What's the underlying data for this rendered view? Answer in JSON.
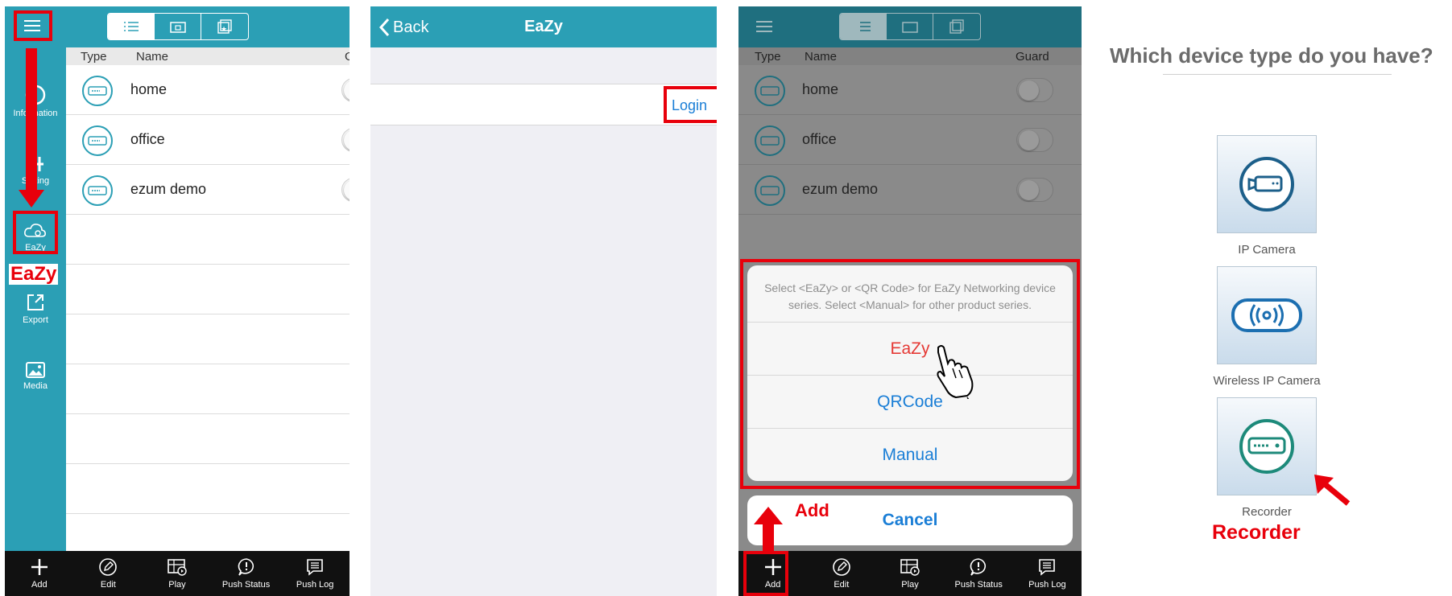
{
  "colors": {
    "accent": "#2b9fb5",
    "accent_dim": "#1f6f7f",
    "annotation_red": "#e8000b",
    "link_blue": "#1a7ed6",
    "eazy_red": "#e53935"
  },
  "screen1": {
    "columns": {
      "type": "Type",
      "name": "Name",
      "guard_partial": "G"
    },
    "devices": [
      {
        "name": "home"
      },
      {
        "name": "office"
      },
      {
        "name": "ezum demo"
      }
    ],
    "sidebar": [
      {
        "label": "Information",
        "icon": "info-icon"
      },
      {
        "label": "Setting",
        "icon": "tools-icon"
      },
      {
        "label": "EaZy",
        "icon": "cloud-gear-icon"
      },
      {
        "label": "Export",
        "icon": "export-icon"
      },
      {
        "label": "Media",
        "icon": "image-icon"
      }
    ],
    "annotation": "EaZy"
  },
  "bottom_bar": [
    {
      "label": "Add",
      "icon": "plus-icon"
    },
    {
      "label": "Edit",
      "icon": "pencil-icon"
    },
    {
      "label": "Play",
      "icon": "play-grid-icon"
    },
    {
      "label": "Push Status",
      "icon": "alert-bubble-icon"
    },
    {
      "label": "Push Log",
      "icon": "log-bubble-icon"
    }
  ],
  "screen2": {
    "back": "Back",
    "title": "EaZy",
    "login": "Login"
  },
  "screen3": {
    "columns": {
      "type": "Type",
      "name": "Name",
      "guard": "Guard"
    },
    "devices": [
      {
        "name": "home"
      },
      {
        "name": "office"
      },
      {
        "name": "ezum demo"
      }
    ],
    "sheet": {
      "message": "Select <EaZy> or <QR Code> for EaZy Networking device series. Select <Manual> for other product series.",
      "eazy": "EaZy",
      "qrcode": "QRCode",
      "manual": "Manual",
      "cancel": "Cancel"
    },
    "annotation": "Add"
  },
  "screen4": {
    "title": "Which device type do you have?",
    "types": [
      {
        "label": "IP Camera",
        "icon": "ip-camera-icon"
      },
      {
        "label": "Wireless IP Camera",
        "icon": "wireless-icon"
      },
      {
        "label": "Recorder",
        "icon": "recorder-icon"
      }
    ],
    "annotation": "Recorder"
  }
}
